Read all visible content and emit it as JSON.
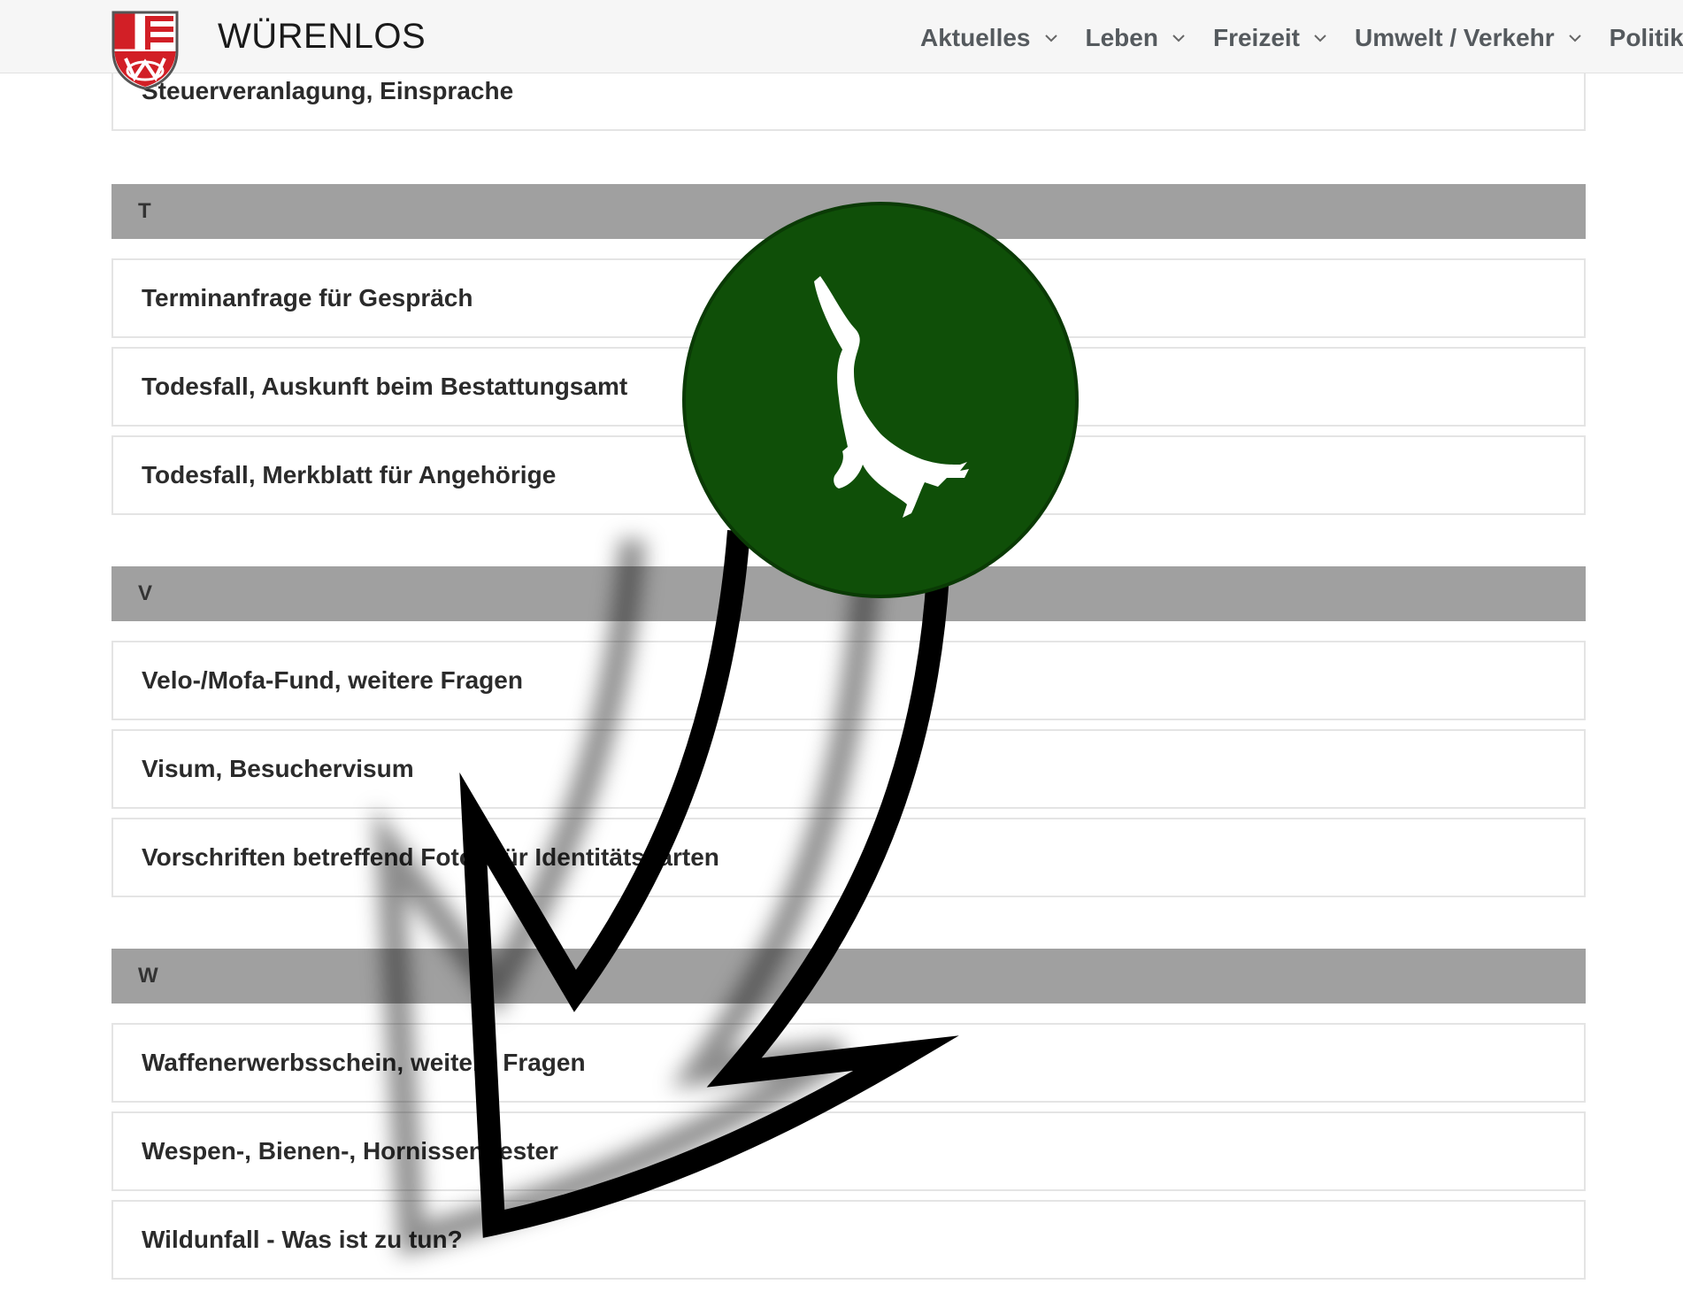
{
  "header": {
    "brand": "WÜRENLOS",
    "nav": [
      {
        "label": "Aktuelles"
      },
      {
        "label": "Leben"
      },
      {
        "label": "Freizeit"
      },
      {
        "label": "Umwelt / Verkehr"
      },
      {
        "label": "Politik"
      }
    ]
  },
  "sections": [
    {
      "letter": "",
      "items": [
        "Steuerveranlagung, Einsprache"
      ]
    },
    {
      "letter": "T",
      "items": [
        "Terminanfrage für Gespräch",
        "Todesfall, Auskunft beim Bestattungsamt",
        "Todesfall, Merkblatt für Angehörige"
      ]
    },
    {
      "letter": "V",
      "items": [
        "Velo-/Mofa-Fund, weitere Fragen",
        "Visum, Besuchervisum",
        "Vorschriften betreffend Fotos für Identitätskarten"
      ]
    },
    {
      "letter": "W",
      "items": [
        "Waffenerwerbsschein, weitere Fragen",
        "Wespen-, Bienen-, Hornissennester",
        "Wildunfall - Was ist zu tun?"
      ]
    }
  ],
  "colors": {
    "letter_bar": "#a0a0a0",
    "badge_green": "#0f4f08",
    "arrow": "#000000",
    "shield_red": "#d21f26"
  },
  "icons": [
    "wuerenlos-coat-of-arms-icon",
    "chevron-down-icon",
    "deer-icon",
    "curved-arrow-icon"
  ]
}
